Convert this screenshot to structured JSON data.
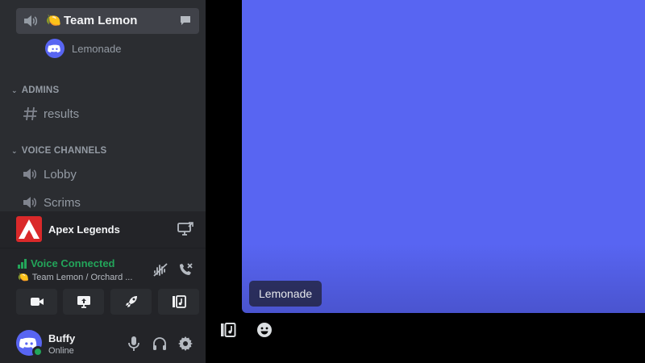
{
  "voice_channel": {
    "emoji": "🍋",
    "name": "Team Lemon"
  },
  "member": {
    "name": "Lemonade"
  },
  "categories": {
    "admins": "ADMINS",
    "voice_channels": "VOICE CHANNELS"
  },
  "channels": {
    "results": "results",
    "lobby": "Lobby",
    "scrims": "Scrims"
  },
  "activity": {
    "name": "Apex Legends"
  },
  "voice_connection": {
    "status": "Voice Connected",
    "emoji": "🍋",
    "location": "Team Lemon / Orchard ..."
  },
  "user": {
    "name": "Buffy",
    "status": "Online"
  },
  "stage": {
    "participant_label": "Lemonade"
  },
  "colors": {
    "accent": "#5865f2",
    "online": "#23a55a",
    "apex_red": "#da292a",
    "sidebar": "#2b2d31",
    "panel": "#232428"
  },
  "icons": {
    "voice_row": [
      "speaker-icon",
      "chat-bubble-icon"
    ],
    "voice_buttons": [
      "camera-icon",
      "screen-share-icon",
      "activity-rocket-icon",
      "soundboard-icon"
    ],
    "user_controls": [
      "microphone-icon",
      "headphones-icon",
      "gear-icon"
    ],
    "stage_bottom": [
      "soundboard-icon",
      "emoji-icon"
    ]
  }
}
